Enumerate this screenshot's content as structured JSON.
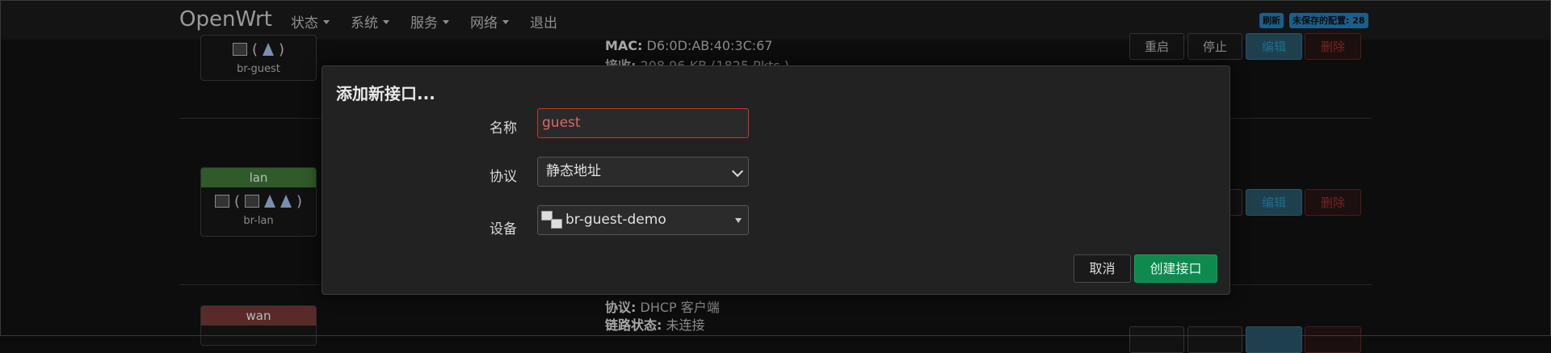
{
  "header": {
    "brand": "OpenWrt",
    "nav": [
      {
        "label": "状态",
        "has_dropdown": true
      },
      {
        "label": "系统",
        "has_dropdown": true
      },
      {
        "label": "服务",
        "has_dropdown": true
      },
      {
        "label": "网络",
        "has_dropdown": true
      },
      {
        "label": "退出",
        "has_dropdown": false
      }
    ],
    "badges": {
      "refresh": "刷新",
      "unsaved": "未保存的配置: 28"
    }
  },
  "background": {
    "interfaces": [
      {
        "name": "",
        "device": "br-guest",
        "header_color": "#111111"
      },
      {
        "name": "lan",
        "device": "br-lan",
        "header_color": "#2f5a2a"
      },
      {
        "name": "wan",
        "device": "",
        "header_color": "#5a2a2a"
      }
    ],
    "info_lines": [
      {
        "key": "MAC:",
        "value": " D6:0D:AB:40:3C:67"
      },
      {
        "key": "接收:",
        "value": " 208.96 KB (1825 Pkts.)"
      },
      {
        "key": "协议:",
        "value": " DHCP 客户端"
      },
      {
        "key": "链路状态:",
        "value": " 未连接"
      }
    ],
    "buttons": {
      "restart": "重启",
      "stop": "停止",
      "edit": "编辑",
      "delete": "删除"
    }
  },
  "modal": {
    "title": "添加新接口...",
    "name_label": "名称",
    "name_value": "guest",
    "protocol_label": "协议",
    "protocol_value": "静态地址",
    "device_label": "设备",
    "device_value": "br-guest-demo",
    "cancel_label": "取消",
    "create_label": "创建接口"
  },
  "colors": {
    "accent_create": "#0e8a4e",
    "field_invalid": "#c0392b",
    "edit_button": "#1e3f4e",
    "delete_button": "#4a1c1c"
  }
}
